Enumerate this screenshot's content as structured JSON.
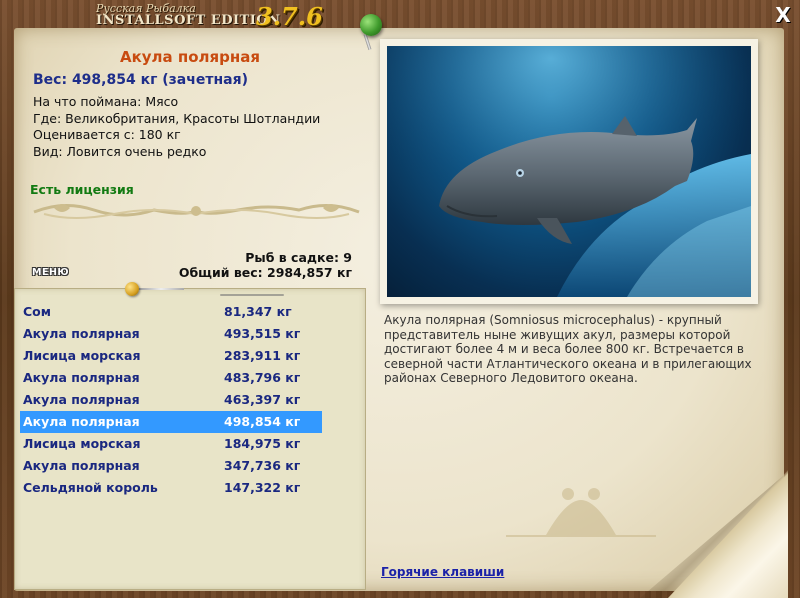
{
  "header": {
    "subtitle": "Русская Рыбалка",
    "title": "INSTALLSOFT EDITION",
    "version": "3.7.6",
    "close_label": "X"
  },
  "fish_info": {
    "name": "Акула полярная",
    "weight": "Вес: 498,854 кг (зачетная)",
    "bait": "На что поймана: Мясо",
    "location": "Где: Великобритания, Красоты Шотландии",
    "rated_from": "Оценивается с: 180 кг",
    "kind": "Вид: Ловится очень редко",
    "license": "Есть лицензия"
  },
  "cage": {
    "count": "Рыб в садке: 9",
    "total": "Общий вес: 2984,857 кг"
  },
  "menu": {
    "label": "МЕНЮ"
  },
  "catch_list": [
    {
      "name": "Сом",
      "weight": "81,347 кг",
      "selected": false
    },
    {
      "name": "Акула полярная",
      "weight": "493,515 кг",
      "selected": false
    },
    {
      "name": "Лисица морская",
      "weight": "283,911 кг",
      "selected": false
    },
    {
      "name": "Акула полярная",
      "weight": "483,796 кг",
      "selected": false
    },
    {
      "name": "Акула полярная",
      "weight": "463,397 кг",
      "selected": false
    },
    {
      "name": "Акула полярная",
      "weight": "498,854 кг",
      "selected": true
    },
    {
      "name": "Лисица морская",
      "weight": "184,975 кг",
      "selected": false
    },
    {
      "name": "Акула полярная",
      "weight": "347,736 кг",
      "selected": false
    },
    {
      "name": "Сельдяной король",
      "weight": "147,322 кг",
      "selected": false
    }
  ],
  "description": "Акула полярная (Somniosus microcephalus) - крупный представитель ныне живущих акул, размеры которой достигают более 4 м и веса более 800 кг. Встречается в северной части Атлантического океана и в прилегающих районах Северного Ледовитого океана.",
  "footer": {
    "hotkeys": "Горячие клавиши"
  },
  "colors": {
    "name_accent": "#c84b10",
    "weight_blue": "#1e2e8a",
    "license_green": "#127a12",
    "selection": "#3399ff",
    "version_gold": "#f0c020"
  },
  "icons": [
    "close-icon",
    "pushpin-icon",
    "ornament-divider",
    "fish-watermark-icon"
  ]
}
